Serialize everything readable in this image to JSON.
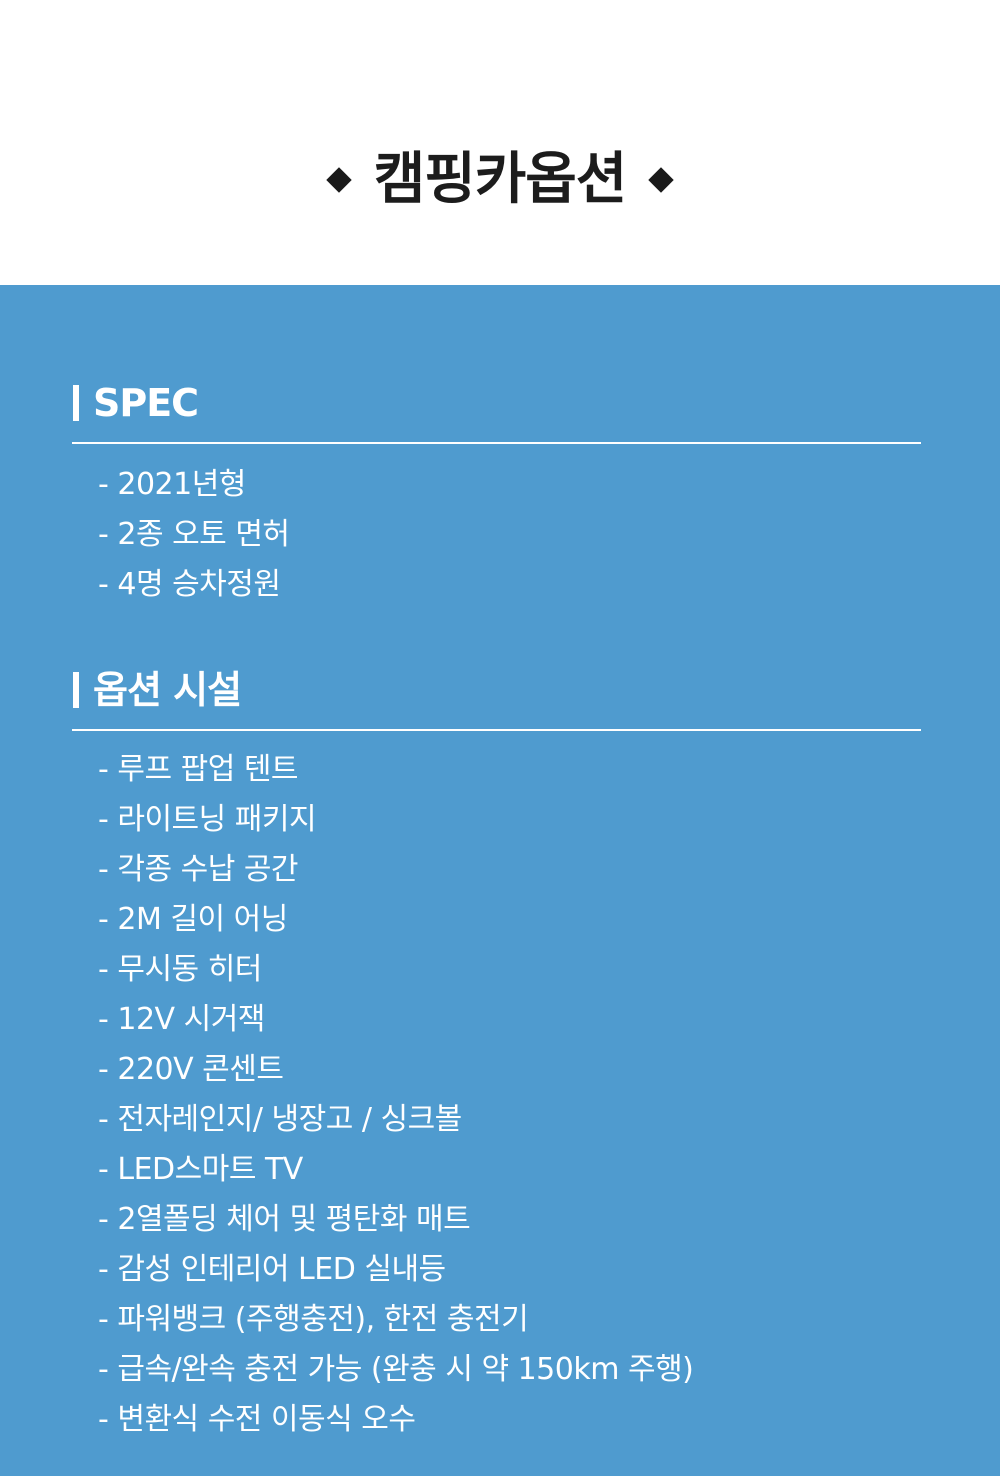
{
  "header": {
    "title": "캠핑카옵션"
  },
  "spec": {
    "title": "SPEC",
    "items": [
      "- 2021년형",
      "- 2종 오토 면허",
      "- 4명 승차정원"
    ]
  },
  "options": {
    "title": "옵션 시설",
    "items": [
      "- 루프 팝업 텐트",
      "- 라이트닝 패키지",
      "- 각종 수납 공간",
      "- 2M 길이 어닝",
      "- 무시동 히터",
      "- 12V 시거잭",
      "- 220V 콘센트",
      "- 전자레인지/ 냉장고 / 싱크볼",
      "- LED스마트 TV",
      "- 2열폴딩 체어 및 평탄화 매트",
      "- 감성 인테리어 LED 실내등",
      "- 파워뱅크 (주행충전), 한전 충전기",
      "- 급속/완속 충전 가능 (완충 시 약 150km 주행)",
      "- 변환식 수전 이동식 오수"
    ]
  },
  "colors": {
    "panel": "#4f9bcf",
    "text_light": "#ffffff",
    "title_dark": "#1c1c1c"
  }
}
